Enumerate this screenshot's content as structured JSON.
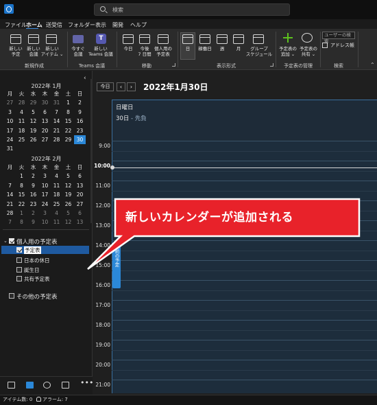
{
  "app": {
    "search_placeholder": "検索"
  },
  "menu": [
    "ファイル",
    "ホーム",
    "送受信",
    "フォルダー",
    "表示",
    "開発",
    "ヘルプ"
  ],
  "ribbon": {
    "new_appointment": "新しい\n予定",
    "new_meeting": "新しい\n会議",
    "new_items": "新しい\nアイテム ⌄",
    "group_new": "新規作成",
    "meet_now": "今すぐ\n会議",
    "new_teams_meeting": "新しい\nTeams 会議",
    "group_teams": "Teams 会議",
    "today": "今日",
    "next7": "今後\n7 日間",
    "personal_cal": "個人用の\n予定表",
    "group_move": "移動",
    "day": "日",
    "workweek": "稼働日",
    "week": "週",
    "month": "月",
    "group_schedule": "グループ\nスケジュール",
    "group_arrange": "表示形式",
    "add_calendar": "予定表の\n追加 ⌄",
    "share_calendar": "予定表の\n共有 ⌄",
    "group_manage": "予定表の管理",
    "user_search": "ユーザーの検索",
    "address_book": "アドレス帳",
    "group_find": "検索"
  },
  "mini_calendars": [
    {
      "title": "2022年 1月",
      "dow": [
        "月",
        "火",
        "水",
        "木",
        "金",
        "土",
        "日"
      ],
      "weeks": [
        [
          "27",
          "28",
          "29",
          "30",
          "31",
          "1",
          "2"
        ],
        [
          "3",
          "4",
          "5",
          "6",
          "7",
          "8",
          "9"
        ],
        [
          "10",
          "11",
          "12",
          "13",
          "14",
          "15",
          "16"
        ],
        [
          "17",
          "18",
          "19",
          "20",
          "21",
          "22",
          "23"
        ],
        [
          "24",
          "25",
          "26",
          "27",
          "28",
          "29",
          "30"
        ],
        [
          "31",
          "",
          "",
          "",
          "",
          "",
          ""
        ]
      ]
    },
    {
      "title": "2022年 2月",
      "dow": [
        "月",
        "火",
        "水",
        "木",
        "金",
        "土",
        "日"
      ],
      "weeks": [
        [
          "",
          "1",
          "2",
          "3",
          "4",
          "5",
          "6"
        ],
        [
          "7",
          "8",
          "9",
          "10",
          "11",
          "12",
          "13"
        ],
        [
          "14",
          "15",
          "16",
          "17",
          "18",
          "19",
          "20"
        ],
        [
          "21",
          "22",
          "23",
          "24",
          "25",
          "26",
          "27"
        ],
        [
          "28",
          "1",
          "2",
          "3",
          "4",
          "5",
          "6"
        ],
        [
          "7",
          "8",
          "9",
          "10",
          "11",
          "12",
          "13"
        ]
      ]
    }
  ],
  "calendar_groups": {
    "personal": "個人用の予定表",
    "items": [
      "予定表",
      "日本の休日",
      "誕生日",
      "共有予定表"
    ],
    "other": "その他の予定表"
  },
  "toolbar": {
    "today": "今日",
    "prev": "‹",
    "next": "›",
    "title": "2022年1月30日"
  },
  "day_view": {
    "day_name": "日曜日",
    "day_date": "30日",
    "rokuyo": " - 先負",
    "times": [
      "9:00",
      "10:00",
      "11:00",
      "12:00",
      "13:00",
      "14:00",
      "15:00",
      "16:00",
      "17:00",
      "18:00",
      "19:00",
      "20:00",
      "21:00"
    ],
    "side_tab": "前の予定"
  },
  "callout": "新しいカレンダーが追加される",
  "status": {
    "items": "アイテム数: 0",
    "alarms": "アラーム: 7"
  },
  "colors": {
    "accent": "#2b88d8",
    "callout_fill": "#e8222a",
    "callout_border": "#ffffff"
  }
}
